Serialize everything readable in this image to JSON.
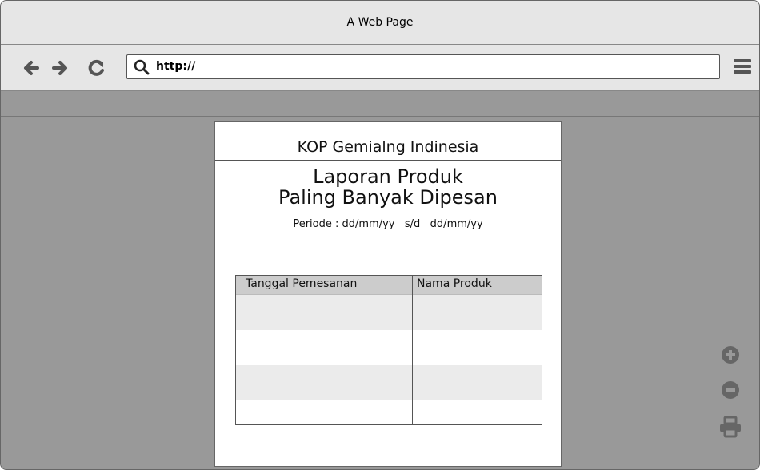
{
  "window": {
    "title": "A Web Page"
  },
  "browser": {
    "url": "http://",
    "icons": {
      "back": "arrow-left-icon",
      "forward": "arrow-right-icon",
      "reload": "reload-icon",
      "search": "search-icon",
      "menu": "hamburger-menu-icon"
    }
  },
  "report": {
    "kop": "KOP Gemialng Indinesia",
    "title_line1": "Laporan Produk",
    "title_line2": "Paling Banyak Dipesan",
    "periode": "Periode : dd/mm/yy   s/d   dd/mm/yy",
    "table": {
      "columns": [
        "Tanggal Pemesanan",
        "Nama Produk"
      ],
      "rows": [
        [
          "",
          ""
        ],
        [
          "",
          ""
        ],
        [
          "",
          ""
        ],
        [
          "",
          ""
        ],
        [
          "",
          ""
        ],
        [
          "",
          ""
        ],
        [
          "",
          ""
        ]
      ]
    }
  },
  "side_tools": {
    "zoom_in": "zoom-in-icon",
    "zoom_out": "zoom-out-icon",
    "print": "print-icon"
  },
  "colors": {
    "chrome": "#e6e6e6",
    "canvas": "#999999",
    "paper": "#ffffff",
    "table_header": "#cccccc",
    "row_alt": "#ebebeb",
    "icon": "#666666"
  }
}
